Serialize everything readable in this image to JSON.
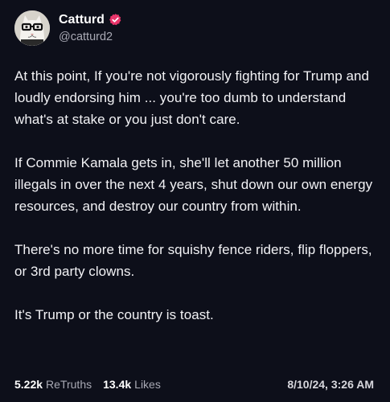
{
  "user": {
    "display_name": "Catturd",
    "handle": "@catturd2",
    "verified_icon": "verified-badge-icon",
    "verified_color": "#e9356b"
  },
  "post": {
    "paragraphs": [
      "At this point, If you're not vigorously fighting for Trump and loudly endorsing him ... you're too dumb to understand what's at stake or you just don't care.",
      "If Commie Kamala gets in, she'll let another 50 million illegals in over the next 4 years, shut down our own energy resources, and destroy our country from within.",
      "There's no more time for squishy fence riders, flip floppers, or 3rd party clowns.",
      "It's Trump or the country is toast."
    ]
  },
  "stats": {
    "retruths_count": "5.22k",
    "retruths_label": "ReTruths",
    "likes_count": "13.4k",
    "likes_label": "Likes",
    "timestamp": "8/10/24, 3:26 AM"
  },
  "colors": {
    "background": "#0d0f1a",
    "text": "#f2f2f5",
    "muted": "#a8a9b4"
  }
}
